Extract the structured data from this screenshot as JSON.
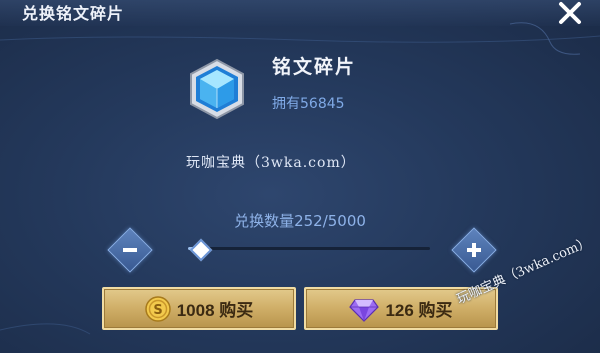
{
  "window": {
    "title": "兑换铭文碎片"
  },
  "item": {
    "name": "铭文碎片",
    "owned_text": "拥有56845",
    "icon": "hexagon-crystal-icon"
  },
  "quantity": {
    "label": "兑换数量252/5000",
    "current": 252,
    "max": 5000
  },
  "actions": {
    "gold_buy": {
      "label": "1008 购买",
      "icon": "gold-coin-icon"
    },
    "gem_buy": {
      "label": "126 购买",
      "icon": "purple-gem-icon"
    }
  },
  "watermarks": {
    "middle": "玩咖宝典（3wka.com）",
    "corner": "玩咖宝典（3wka.com）"
  },
  "colors": {
    "accent_blue": "#7fa9e6",
    "button_gold": "#cfae67",
    "background": "#24395c"
  }
}
